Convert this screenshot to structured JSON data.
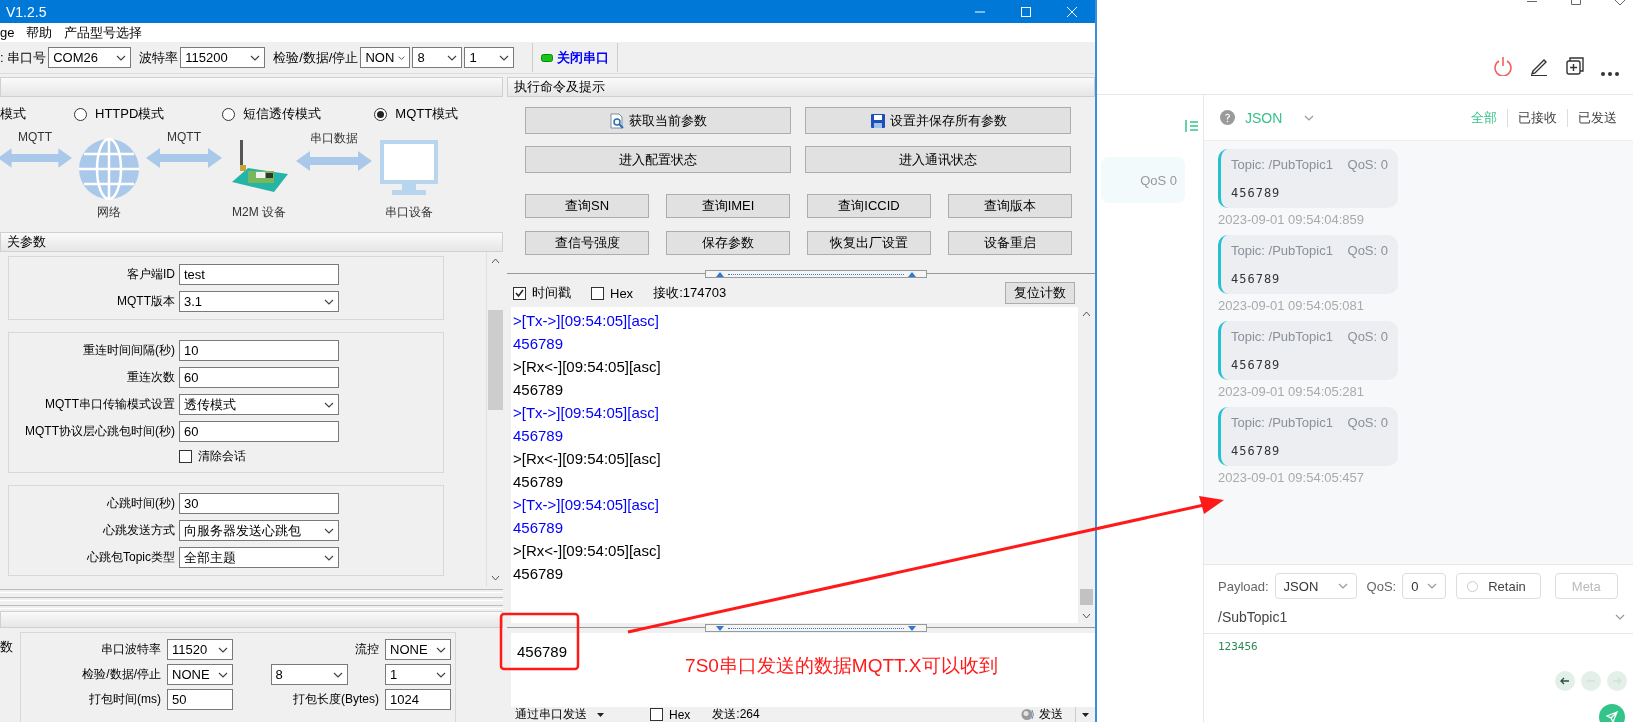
{
  "serial_tool": {
    "window": {
      "title": "V1.2.5"
    },
    "menu": [
      {
        "label": "ge"
      },
      {
        "label": "帮助"
      },
      {
        "label": "产品型号选择"
      }
    ],
    "toolbar": {
      "fields": [
        {
          "label": ": 串口号",
          "selects": [
            "COM26"
          ]
        },
        {
          "label": "波特率",
          "selects": [
            "115200"
          ]
        },
        {
          "label": "检验/数据/停止",
          "selects": [
            "NON",
            "8",
            "1"
          ]
        }
      ],
      "port_button": {
        "label": "关闭串口",
        "open": true
      }
    },
    "mode_label_cut": "模式",
    "modes": [
      {
        "label": "HTTPD模式",
        "selected": false
      },
      {
        "label": "短信透传模式",
        "selected": false
      },
      {
        "label": "MQTT模式",
        "selected": true
      }
    ],
    "diagram": {
      "links": [
        "MQTT",
        "MQTT",
        "串口数据"
      ],
      "nodes": [
        {
          "kind": "globe",
          "label": "网络"
        },
        {
          "kind": "device",
          "label": "M2M 设备"
        },
        {
          "kind": "monitor",
          "label": "串口设备"
        }
      ]
    },
    "config": {
      "title": "关参数",
      "groups": [
        {
          "rows": [
            {
              "kind": "text",
              "label": "客户端ID",
              "value": "test"
            },
            {
              "kind": "select",
              "label": "MQTT版本",
              "value": "3.1"
            }
          ]
        },
        {
          "rows": [
            {
              "kind": "text",
              "label": "重连时间间隔(秒)",
              "value": "10"
            },
            {
              "kind": "text",
              "label": "重连次数",
              "value": "60"
            },
            {
              "kind": "select",
              "label": "MQTT串口传输模式设置",
              "value": "透传模式"
            },
            {
              "kind": "text",
              "label": "MQTT协议层心跳包时间(秒)",
              "value": "60"
            },
            {
              "kind": "checkbox",
              "label": "清除会话",
              "checked": false
            }
          ]
        },
        {
          "rows": [
            {
              "kind": "text",
              "label": "心跳时间(秒)",
              "value": "30"
            },
            {
              "kind": "select",
              "label": "心跳发送方式",
              "value": "向服务器发送心跳包"
            },
            {
              "kind": "select",
              "label": "心跳包Topic类型",
              "value": "全部主题"
            }
          ]
        }
      ]
    },
    "serial_params": {
      "title": "数",
      "cells": [
        {
          "kind": "label",
          "text": "串口波特率"
        },
        {
          "kind": "select",
          "value": "11520"
        },
        {
          "kind": "label",
          "text": "流控"
        },
        {
          "kind": "select",
          "value": "NONE"
        },
        {
          "kind": "label",
          "text": "检验/数据/停止"
        },
        {
          "kind": "select",
          "value": "NONE"
        },
        {
          "kind": "select",
          "value": "8"
        },
        {
          "kind": "select",
          "value": "1"
        },
        {
          "kind": "label",
          "text": "打包时间(ms)"
        },
        {
          "kind": "text",
          "value": "50"
        },
        {
          "kind": "label",
          "text": "打包长度(Bytes)"
        },
        {
          "kind": "text",
          "value": "1024"
        }
      ]
    },
    "commands": {
      "title": "执行命令及提示",
      "wide_buttons": [
        {
          "label": "获取当前参数"
        },
        {
          "label": "设置并保存所有参数"
        },
        {
          "label": "进入配置状态"
        },
        {
          "label": "进入通讯状态"
        }
      ],
      "buttons": [
        {
          "label": "查询SN"
        },
        {
          "label": "查询IMEI"
        },
        {
          "label": "查询ICCID"
        },
        {
          "label": "查询版本"
        },
        {
          "label": "查信号强度"
        },
        {
          "label": "保存参数"
        },
        {
          "label": "恢复出厂设置"
        },
        {
          "label": "设备重启"
        }
      ]
    },
    "receive": {
      "options": [
        {
          "label": "时间戳",
          "checked": true
        },
        {
          "label": "Hex",
          "checked": false
        }
      ],
      "count": "接收:174703",
      "reset_button": "复位计数",
      "log": [
        {
          "kind": "tx",
          "text": ">[Tx->][09:54:05][asc]"
        },
        {
          "kind": "tx",
          "text": "456789"
        },
        {
          "kind": "rx",
          "text": ">[Rx<-][09:54:05][asc]"
        },
        {
          "kind": "rx",
          "text": "456789"
        },
        {
          "kind": "tx",
          "text": ">[Tx->][09:54:05][asc]"
        },
        {
          "kind": "tx",
          "text": "456789"
        },
        {
          "kind": "rx",
          "text": ">[Rx<-][09:54:05][asc]"
        },
        {
          "kind": "rx",
          "text": "456789"
        },
        {
          "kind": "tx",
          "text": ">[Tx->][09:54:05][asc]"
        },
        {
          "kind": "tx",
          "text": "456789"
        },
        {
          "kind": "rx",
          "text": ">[Rx<-][09:54:05][asc]"
        },
        {
          "kind": "rx",
          "text": "456789"
        }
      ]
    },
    "send": {
      "text": "456789",
      "annotation": "7S0串口发送的数据MQTT.X可以收到",
      "mode_button": "通过串口发送",
      "hex": {
        "label": "Hex",
        "checked": false
      },
      "count": "发送:264",
      "send_button": "发送"
    }
  },
  "mqttx": {
    "sidebar_item": "QoS 0",
    "format": "JSON",
    "filters": [
      {
        "label": "全部",
        "selected": true
      },
      {
        "label": "已接收",
        "selected": false
      },
      {
        "label": "已发送",
        "selected": false
      }
    ],
    "messages": [
      {
        "topic": "Topic: /PubTopic1",
        "qos": "QoS: 0",
        "payload": "456789",
        "time": "2023-09-01 09:54:04:859"
      },
      {
        "topic": "Topic: /PubTopic1",
        "qos": "QoS: 0",
        "payload": "456789",
        "time": "2023-09-01 09:54:05:081"
      },
      {
        "topic": "Topic: /PubTopic1",
        "qos": "QoS: 0",
        "payload": "456789",
        "time": "2023-09-01 09:54:05:281"
      },
      {
        "topic": "Topic: /PubTopic1",
        "qos": "QoS: 0",
        "payload": "456789",
        "time": "2023-09-01 09:54:05:457"
      }
    ],
    "composer": {
      "payload_label": "Payload:",
      "payload_format": "JSON",
      "qos_label": "QoS:",
      "qos": "0",
      "retain": {
        "label": "Retain",
        "checked": false
      },
      "meta_button": "Meta",
      "topic": "/SubTopic1",
      "payload": "123456"
    }
  }
}
